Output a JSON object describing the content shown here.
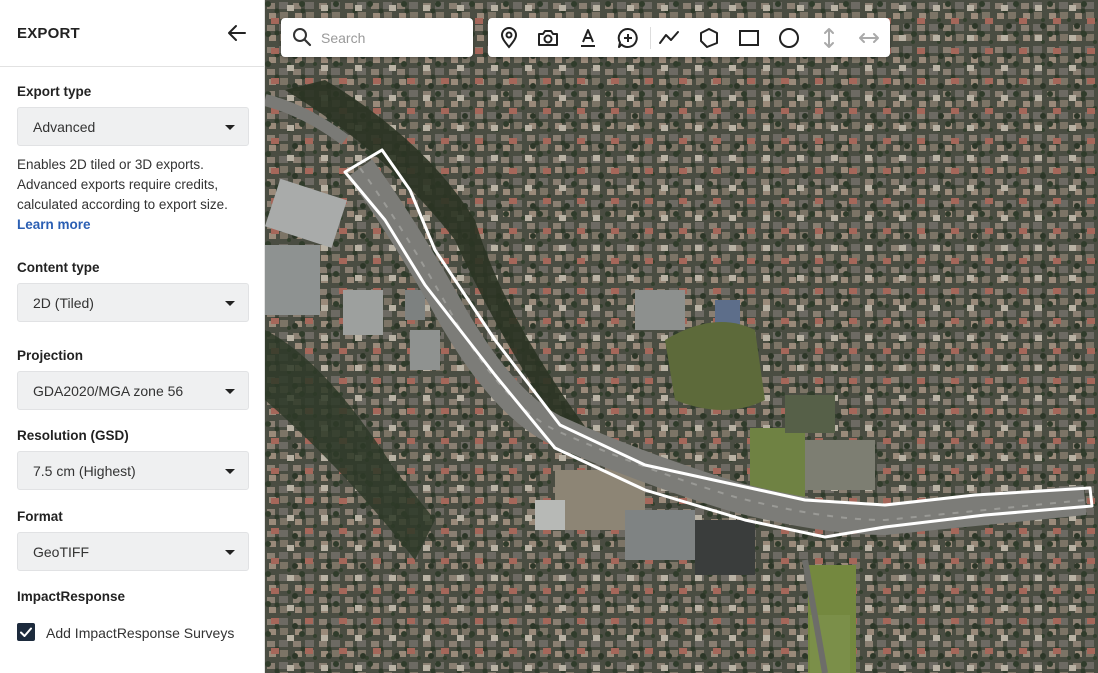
{
  "sidebar": {
    "title": "EXPORT",
    "export_type": {
      "label": "Export type",
      "value": "Advanced",
      "description": "Enables 2D tiled or 3D exports. Advanced exports require credits, calculated according to export size.",
      "learn_more": "Learn more"
    },
    "content_type": {
      "label": "Content type",
      "value": "2D (Tiled)"
    },
    "projection": {
      "label": "Projection",
      "value": "GDA2020/MGA zone 56"
    },
    "resolution": {
      "label": "Resolution (GSD)",
      "value": "7.5 cm (Highest)"
    },
    "format": {
      "label": "Format",
      "value": "GeoTIFF"
    },
    "impact_response": {
      "label": "ImpactResponse",
      "checkbox_label": "Add ImpactResponse Surveys",
      "checked": true
    }
  },
  "map": {
    "search": {
      "placeholder": "Search"
    },
    "toolbar": {
      "tools": [
        "location-pin-icon",
        "camera-icon",
        "text-annotation-icon",
        "add-comment-icon",
        "polyline-icon",
        "polygon-icon",
        "rectangle-icon",
        "circle-icon",
        "vertical-measure-icon",
        "horizontal-measure-icon"
      ]
    }
  },
  "colors": {
    "accent_link": "#2b5fb3",
    "checkbox_fill": "#1d2b3d",
    "select_bg": "#eff0f1",
    "selection_outline": "#ffffff"
  }
}
